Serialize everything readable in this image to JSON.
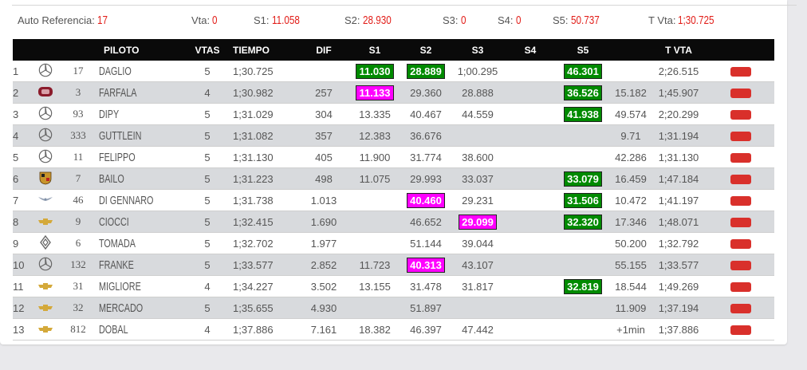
{
  "header": {
    "auto_ref_label": "Auto Referencia:",
    "auto_ref_value": "17",
    "vta_label": "Vta:",
    "vta_value": "0",
    "s1_label": "S1:",
    "s1_value": "11.058",
    "s2_label": "S2:",
    "s2_value": "28.930",
    "s3_label": "S3:",
    "s3_value": "0",
    "s4_label": "S4:",
    "s4_value": "0",
    "s5_label": "S5:",
    "s5_value": "50.737",
    "tvta_label": "T Vta:",
    "tvta_value": "1;30.725"
  },
  "columns": [
    "PILOTO",
    "VTAS",
    "TIEMPO",
    "DIF",
    "S1",
    "S2",
    "S3",
    "S4",
    "S5",
    "T VTA"
  ],
  "colors": {
    "green": "#008a00",
    "magenta": "#ff00ff",
    "button_red": "#d9302b"
  },
  "rows": [
    {
      "pos": "1",
      "brand_icon": "mercedes-icon",
      "num": "17",
      "piloto": "DAGLIO",
      "vtas": "5",
      "tiempo": "1;30.725",
      "dif": "",
      "s1": "11.030",
      "s1_hl": "green",
      "s2": "28.889",
      "s2_hl": "green",
      "s3": "1;00.295",
      "s3_hl": "",
      "s4": "",
      "s5": "46.301",
      "s5_hl": "green",
      "gap": "",
      "tvta": "2;26.515"
    },
    {
      "pos": "2",
      "brand_icon": "fiat-icon",
      "num": "3",
      "piloto": "FARFALA",
      "vtas": "4",
      "tiempo": "1;30.982",
      "dif": "257",
      "s1": "11.133",
      "s1_hl": "magenta",
      "s2": "29.360",
      "s2_hl": "",
      "s3": "28.888",
      "s3_hl": "",
      "s4": "",
      "s5": "36.526",
      "s5_hl": "green",
      "gap": "15.182",
      "tvta": "1;45.907"
    },
    {
      "pos": "3",
      "brand_icon": "mercedes-icon",
      "num": "93",
      "piloto": "DIPY",
      "vtas": "5",
      "tiempo": "1;31.029",
      "dif": "304",
      "s1": "13.335",
      "s1_hl": "",
      "s2": "40.467",
      "s2_hl": "",
      "s3": "44.559",
      "s3_hl": "",
      "s4": "",
      "s5": "41.938",
      "s5_hl": "green",
      "gap": "49.574",
      "tvta": "2;20.299"
    },
    {
      "pos": "4",
      "brand_icon": "mercedes-icon",
      "num": "333",
      "piloto": "GUTTLEIN",
      "vtas": "5",
      "tiempo": "1;31.082",
      "dif": "357",
      "s1": "12.383",
      "s1_hl": "",
      "s2": "36.676",
      "s2_hl": "",
      "s3": "",
      "s3_hl": "",
      "s4": "",
      "s5": "",
      "s5_hl": "",
      "gap": "9.71",
      "tvta": "1;31.194"
    },
    {
      "pos": "5",
      "brand_icon": "mercedes-icon",
      "num": "11",
      "piloto": "FELIPPO",
      "vtas": "5",
      "tiempo": "1;31.130",
      "dif": "405",
      "s1": "11.900",
      "s1_hl": "",
      "s2": "31.774",
      "s2_hl": "",
      "s3": "38.600",
      "s3_hl": "",
      "s4": "",
      "s5": "",
      "s5_hl": "",
      "gap": "42.286",
      "tvta": "1;31.130"
    },
    {
      "pos": "6",
      "brand_icon": "porsche-icon",
      "num": "7",
      "piloto": "BAILO",
      "vtas": "5",
      "tiempo": "1;31.223",
      "dif": "498",
      "s1": "11.075",
      "s1_hl": "",
      "s2": "29.993",
      "s2_hl": "",
      "s3": "33.037",
      "s3_hl": "",
      "s4": "",
      "s5": "33.079",
      "s5_hl": "green",
      "gap": "16.459",
      "tvta": "1;47.184"
    },
    {
      "pos": "7",
      "brand_icon": "wings-icon",
      "num": "46",
      "piloto": "DI GENNARO",
      "vtas": "5",
      "tiempo": "1;31.738",
      "dif": "1.013",
      "s1": "",
      "s1_hl": "",
      "s2": "40.460",
      "s2_hl": "magenta",
      "s3": "29.231",
      "s3_hl": "",
      "s4": "",
      "s5": "31.506",
      "s5_hl": "green",
      "gap": "10.472",
      "tvta": "1;41.197"
    },
    {
      "pos": "8",
      "brand_icon": "chevrolet-icon",
      "num": "9",
      "piloto": "CIOCCI",
      "vtas": "5",
      "tiempo": "1;32.415",
      "dif": "1.690",
      "s1": "",
      "s1_hl": "",
      "s2": "46.652",
      "s2_hl": "",
      "s3": "29.099",
      "s3_hl": "magenta",
      "s4": "",
      "s5": "32.320",
      "s5_hl": "green",
      "gap": "17.346",
      "tvta": "1;48.071"
    },
    {
      "pos": "9",
      "brand_icon": "renault-icon",
      "num": "6",
      "piloto": "TOMADA",
      "vtas": "5",
      "tiempo": "1;32.702",
      "dif": "1.977",
      "s1": "",
      "s1_hl": "",
      "s2": "51.144",
      "s2_hl": "",
      "s3": "39.044",
      "s3_hl": "",
      "s4": "",
      "s5": "",
      "s5_hl": "",
      "gap": "50.200",
      "tvta": "1;32.792"
    },
    {
      "pos": "10",
      "brand_icon": "mercedes-icon",
      "num": "132",
      "piloto": "FRANKE",
      "vtas": "5",
      "tiempo": "1;33.577",
      "dif": "2.852",
      "s1": "11.723",
      "s1_hl": "",
      "s2": "40.313",
      "s2_hl": "magenta",
      "s3": "43.107",
      "s3_hl": "",
      "s4": "",
      "s5": "",
      "s5_hl": "",
      "gap": "55.155",
      "tvta": "1;33.577"
    },
    {
      "pos": "11",
      "brand_icon": "chevrolet-icon",
      "num": "31",
      "piloto": "MIGLIORE",
      "vtas": "4",
      "tiempo": "1;34.227",
      "dif": "3.502",
      "s1": "13.155",
      "s1_hl": "",
      "s2": "31.478",
      "s2_hl": "",
      "s3": "31.817",
      "s3_hl": "",
      "s4": "",
      "s5": "32.819",
      "s5_hl": "green",
      "gap": "18.544",
      "tvta": "1;49.269"
    },
    {
      "pos": "12",
      "brand_icon": "chevrolet-icon",
      "num": "32",
      "piloto": "MERCADO",
      "vtas": "5",
      "tiempo": "1;35.655",
      "dif": "4.930",
      "s1": "",
      "s1_hl": "",
      "s2": "51.897",
      "s2_hl": "",
      "s3": "",
      "s3_hl": "",
      "s4": "",
      "s5": "",
      "s5_hl": "",
      "gap": "11.909",
      "tvta": "1;37.194"
    },
    {
      "pos": "13",
      "brand_icon": "chevrolet-icon",
      "num": "812",
      "piloto": "DOBAL",
      "vtas": "4",
      "tiempo": "1;37.886",
      "dif": "7.161",
      "s1": "18.382",
      "s1_hl": "",
      "s2": "46.397",
      "s2_hl": "",
      "s3": "47.442",
      "s3_hl": "",
      "s4": "",
      "s5": "",
      "s5_hl": "",
      "gap": "+1min",
      "tvta": "1;37.886"
    }
  ]
}
